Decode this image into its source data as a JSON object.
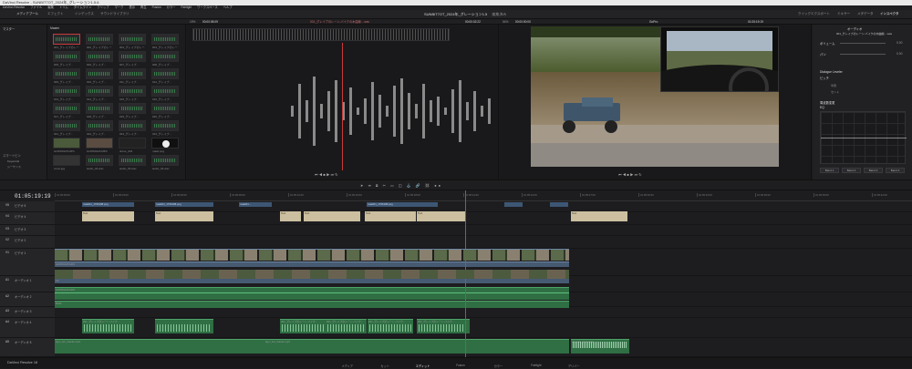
{
  "window": {
    "title": "DaVinci Resolve - SUNBIT7OT_2024年_グレーション1.5.6"
  },
  "menu": [
    "DaVinci Resolve",
    "ファイル",
    "編集",
    "トリム",
    "タイムライン",
    "クリップ",
    "マーク",
    "表示",
    "再生",
    "Fusion",
    "カラー",
    "Fairlight",
    "ワークスペース",
    "ヘルプ"
  ],
  "toolbar": {
    "media_pool": "メディアプール",
    "effects": "エフェクト",
    "edit_index": "インデックス",
    "sound_library": "サウンドライブラリ",
    "project_title": "SUNBIT7OT_2024年_グレーション1.5",
    "edited": "編集済み",
    "mixer": "ミキサー",
    "metadata": "メタデータ",
    "inspector": "インスペクタ",
    "quick_export": "クイックエクスポート"
  },
  "source_viewer": {
    "zoom": "19%",
    "timecode": "00:00:05:09",
    "clip_name": "001_グレイブのレーン-バイクの木曲線....wav",
    "duration": "00:00:02:22"
  },
  "timeline_viewer": {
    "zoom": "54%",
    "timecode_left": "00:00:00:00",
    "timecode_right": "01:05:19:19",
    "timeline_name": "GoPro"
  },
  "left_panel": {
    "header": "マスター",
    "items": [
      "スマートビン",
      "Keywords",
      "シーケンス"
    ]
  },
  "media_pool_header": "Master",
  "media_items": [
    "001_グレイブのレーン...",
    "002_グレイブのレーン...",
    "003_グレイブのレーン...",
    "004_グレイブのレーン...",
    "005_グレイブ...",
    "006_グレイブ...",
    "007_グレイブ...",
    "008_グレイブ...",
    "009_グレイブ...",
    "010_グレイブ...",
    "011_グレイブ...",
    "012_グレイブ...",
    "013_グレイブ...",
    "014_グレイブ...",
    "015_グレイブ...",
    "016_グレイブ...",
    "017_グレイブ...",
    "018_グレイブ...",
    "019_グレイブ...",
    "020_グレイブ...",
    "021_グレイブ...",
    "022_グレイブ...",
    "023_グレイブ...",
    "024_グレイブ...",
    "GOPR0125.MP4",
    "GOPR0126.MP4",
    "drone_001",
    "mask.png",
    "cover.jpg",
    "audio_02.wav",
    "audio_03.wav",
    "audio_04.wav"
  ],
  "inspector": {
    "header": "オーディオ",
    "clip_name": "001_グレイブのレーン-バイクの木曲線....wav",
    "volume_label": "ボリューム",
    "volume_value": "0.00",
    "pan_label": "パン",
    "pan_value": "0.00",
    "pitch_label": "ピッチ",
    "dialogue_leveler": "Dialogue Leveler",
    "eq_label": "EQ",
    "eq_header": "周波数変更",
    "bands": [
      "Band 1",
      "Band 2",
      "Band 3",
      "Band 4"
    ],
    "semitone_label": "半音",
    "cents_label": "セント"
  },
  "timeline": {
    "timecode": "01:05:19:19",
    "ruler": [
      "01:05:00:00",
      "01:05:03:00",
      "01:05:06:00",
      "01:05:09:00",
      "01:05:12:00",
      "01:05:15:00",
      "01:05:18:00",
      "01:05:21:00",
      "01:05:24:00",
      "01:05:27:00",
      "01:05:30:00",
      "01:05:33:00",
      "01:05:36:00",
      "01:05:39:00",
      "01:05:42:00"
    ],
    "tracks": [
      {
        "id": "V5",
        "name": "ビデオ 5"
      },
      {
        "id": "V4",
        "name": "ビデオ 4"
      },
      {
        "id": "V3",
        "name": "ビデオ 3"
      },
      {
        "id": "V2",
        "name": "ビデオ 2"
      },
      {
        "id": "V1",
        "name": "ビデオ 1"
      },
      {
        "id": "A1",
        "name": "オーディオ 1"
      },
      {
        "id": "A2",
        "name": "オーディオ 2"
      },
      {
        "id": "A3",
        "name": "オーディオ 3"
      },
      {
        "id": "A4",
        "name": "オーディオ 4"
      },
      {
        "id": "A5",
        "name": "オーディオ 5"
      }
    ],
    "clip_labels": {
      "v5_a": "mask01_1706198.png",
      "v5_b": "mask01_1706198.png",
      "v5_c": "mask01...",
      "v5_d": "mask01_1706198.png",
      "text": "Text",
      "v1": "GOPR0125.MP4",
      "v1_b": "FX",
      "a1": "GOPR0125.MP4",
      "a3": "BGM",
      "a4": "001_グレイブのレーン-バイク...",
      "a5_a": "bgm_fun_thanks.mp3",
      "a5_b": "bgm_fun_thanks.mp3",
      "a5_c": "cheerful_wind.mp3"
    }
  },
  "pages": [
    "メディア",
    "カット",
    "エディット",
    "Fusion",
    "カラー",
    "Fairlight",
    "デリバー"
  ],
  "brand": "DaVinci Resolve 18"
}
